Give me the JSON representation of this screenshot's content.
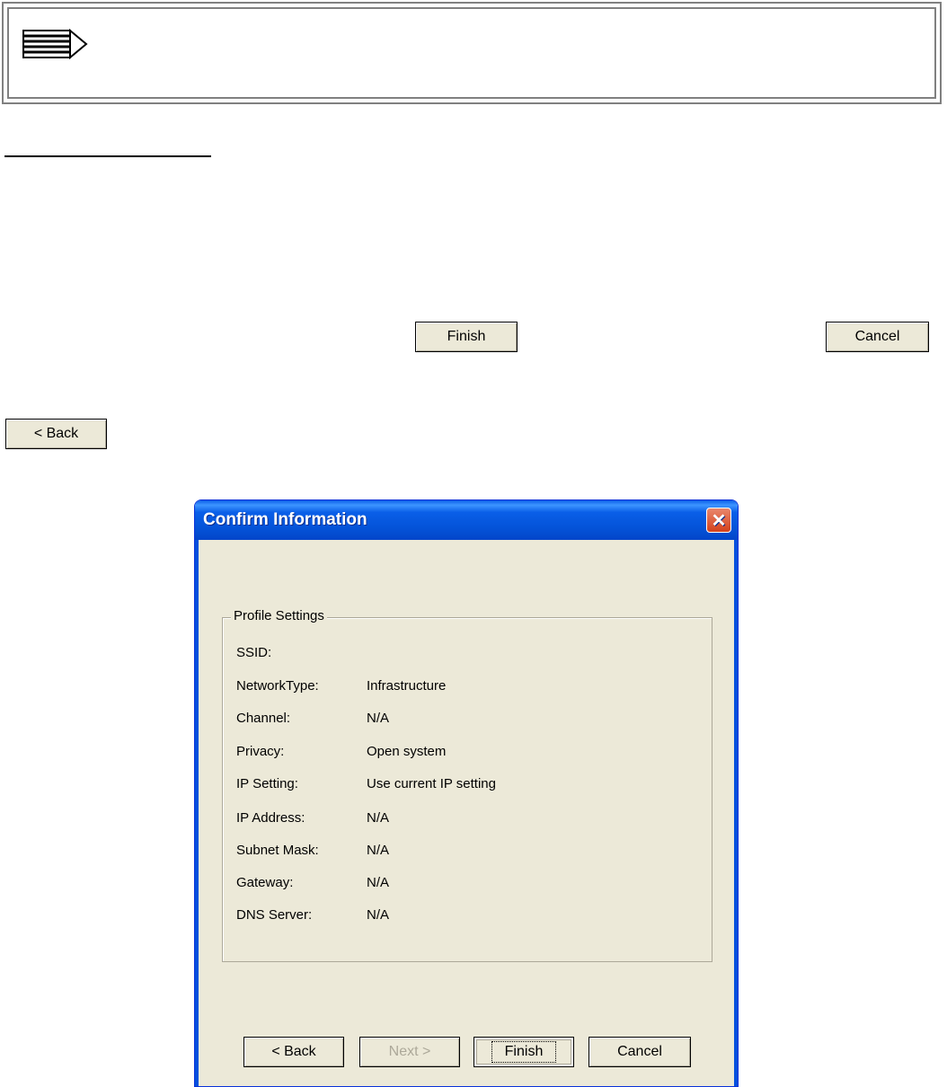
{
  "note_box": {
    "icon": "pencil-note-icon"
  },
  "document": {
    "finish_button": "Finish",
    "cancel_button": "Cancel",
    "back_button": "< Back"
  },
  "dialog": {
    "title": "Confirm Information",
    "close_icon": "close-icon",
    "group_title": "Profile Settings",
    "rows": [
      {
        "label": "SSID:",
        "value": ""
      },
      {
        "label": "NetworkType:",
        "value": "Infrastructure"
      },
      {
        "label": "Channel:",
        "value": "N/A"
      },
      {
        "label": "Privacy:",
        "value": "Open system"
      },
      {
        "label": "IP Setting:",
        "value": "Use current IP setting"
      },
      {
        "label": "IP Address:",
        "value": "N/A"
      },
      {
        "label": "Subnet Mask:",
        "value": "N/A"
      },
      {
        "label": "Gateway:",
        "value": "N/A"
      },
      {
        "label": "DNS Server:",
        "value": "N/A"
      }
    ],
    "buttons": {
      "back": "< Back",
      "next": "Next >",
      "finish": "Finish",
      "cancel": "Cancel"
    }
  },
  "colors": {
    "titlebar": "#0453d8",
    "dialog_bg": "#ece9d8",
    "close": "#d4411b"
  }
}
